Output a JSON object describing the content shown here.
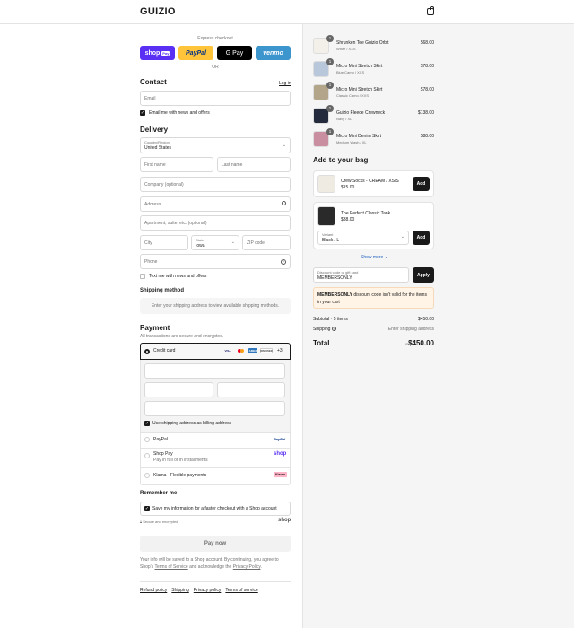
{
  "header": {
    "logo": "GUIZIO",
    "cart_icon": "shopping-bag-icon"
  },
  "express": {
    "label": "Express checkout",
    "shop_pay": "shop",
    "shop_pay_tag": "Pay",
    "paypal": "PayPal",
    "gpay": "G Pay",
    "venmo": "venmo",
    "or": "OR"
  },
  "contact": {
    "title": "Contact",
    "login": "Log in",
    "email_placeholder": "Email",
    "email_news": "Email me with news and offers"
  },
  "delivery": {
    "title": "Delivery",
    "country_label": "Country/Region",
    "country": "United States",
    "first_name": "First name",
    "last_name": "Last name",
    "company": "Company (optional)",
    "address": "Address",
    "apartment": "Apartment, suite, etc. (optional)",
    "city": "City",
    "state_label": "State",
    "state": "Iowa",
    "zip": "ZIP code",
    "phone": "Phone",
    "text_news": "Text me with news and offers"
  },
  "shipping": {
    "title": "Shipping method",
    "placeholder": "Enter your shipping address to view available shipping methods."
  },
  "payment": {
    "title": "Payment",
    "subtitle": "All transactions are secure and encrypted.",
    "credit_card": "Credit card",
    "cards": [
      "VISA",
      "MC",
      "AMEX",
      "DISCOVER"
    ],
    "more": "+3",
    "billing": "Use shipping address as billing address",
    "paypal": "PayPal",
    "paypal_logo": "PayPal",
    "shop_pay": "Shop Pay",
    "shop_pay_sub": "Pay in full or in installments",
    "shop_logo": "shop",
    "klarna": "Klarna - Flexible payments",
    "klarna_logo": "Klarna"
  },
  "remember": {
    "title": "Remember me",
    "save": "Save my information for a faster checkout with a Shop account",
    "secure": "Secure and encrypted",
    "shop": "shop"
  },
  "pay": {
    "button": "Pay now",
    "note1": "Your info will be saved to a Shop account. By continuing, you agree to Shop's",
    "terms": "Terms of Service",
    "note2": " and acknowledge the ",
    "privacy": "Privacy Policy",
    "dot": "."
  },
  "footer": {
    "links": [
      "Refund policy",
      "Shipping",
      "Privacy policy",
      "Terms of service"
    ]
  },
  "order": {
    "items": [
      {
        "qty": "1",
        "name": "Shrunken Tee Guizio Orbit",
        "variant": "White / XXS",
        "price": "$68.00",
        "color": "#f3f0ea"
      },
      {
        "qty": "1",
        "name": "Micro Mini Stretch Skirt",
        "variant": "Blue Camo / XXS",
        "price": "$78.00",
        "color": "#b9c7db"
      },
      {
        "qty": "1",
        "name": "Micro Mini Stretch Skirt",
        "variant": "Classic Camo / XXS",
        "price": "$78.00",
        "color": "#b3a58a"
      },
      {
        "qty": "1",
        "name": "Guizio Fleece Crewneck",
        "variant": "Navy / XL",
        "price": "$138.00",
        "color": "#232b3d"
      },
      {
        "qty": "1",
        "name": "Micro Mini Denim Skirt",
        "variant": "Medium Wash / XL",
        "price": "$88.00",
        "color": "#c98ea0"
      }
    ]
  },
  "upsell": {
    "title": "Add to your bag",
    "item1": {
      "name": "Crew Socks - CREAM / XS/S",
      "price": "$15.00",
      "button": "Add"
    },
    "item2": {
      "name": "The Perfect Classic Tank",
      "price": "$38.00",
      "variant_label": "Variant",
      "variant": "Black / L",
      "button": "Add"
    },
    "show_more": "Show more"
  },
  "discount": {
    "label": "Discount code or gift card",
    "value": "MEMBERSONLY",
    "button": "Apply",
    "error_code": "MEMBERSONLY",
    "error_text": " discount code isn't valid for the items in your cart"
  },
  "summary": {
    "subtotal_label": "Subtotal · 5 items",
    "subtotal": "$450.00",
    "shipping_label": "Shipping",
    "shipping": "Enter shipping address",
    "total_label": "Total",
    "currency": "USD",
    "total": "$450.00"
  }
}
